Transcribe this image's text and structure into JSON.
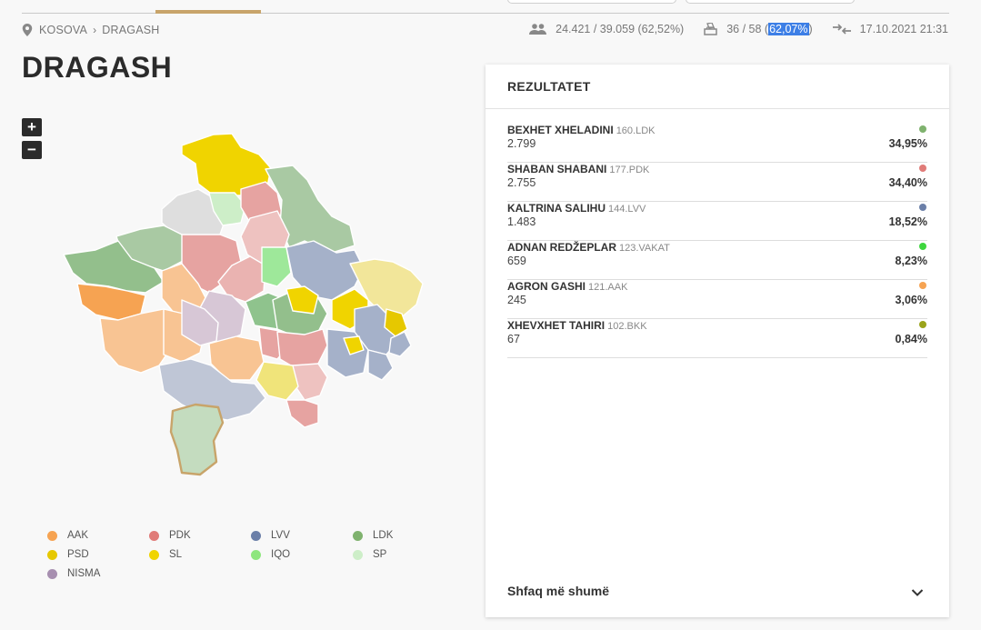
{
  "breadcrumb": {
    "root": "KOSOVA",
    "separator": "›",
    "current": "DRAGASH"
  },
  "stats": {
    "voters": "24.421 / 39.059 (62,52%)",
    "stations_prefix": "36 / 58 (",
    "stations_highlight": "62,07%",
    "stations_suffix": ")",
    "updated": "17.10.2021 21:31"
  },
  "page_title": "DRAGASH",
  "zoom": {
    "in_label": "+",
    "out_label": "−"
  },
  "results": {
    "title": "REZULTATET",
    "candidates": [
      {
        "name": "BEXHET XHELADINI",
        "code": "160.LDK",
        "votes": "2.799",
        "percent": "34,95%",
        "color": "#7fb26e"
      },
      {
        "name": "SHABAN SHABANI",
        "code": "177.PDK",
        "votes": "2.755",
        "percent": "34,40%",
        "color": "#e07b78"
      },
      {
        "name": "KALTRINA SALIHU",
        "code": "144.LVV",
        "votes": "1.483",
        "percent": "18,52%",
        "color": "#6b7fa8"
      },
      {
        "name": "ADNAN REDŽEPLAR",
        "code": "123.VAKAT",
        "votes": "659",
        "percent": "8,23%",
        "color": "#3ed63e"
      },
      {
        "name": "AGRON GASHI",
        "code": "121.AAK",
        "votes": "245",
        "percent": "3,06%",
        "color": "#f6a352"
      },
      {
        "name": "XHEVXHET TAHIRI",
        "code": "102.BKK",
        "votes": "67",
        "percent": "0,84%",
        "color": "#9aa31a"
      }
    ],
    "show_more": "Shfaq më shumë"
  },
  "legend": [
    {
      "label": "AAK",
      "color": "#f6a352"
    },
    {
      "label": "PDK",
      "color": "#e07b78"
    },
    {
      "label": "LVV",
      "color": "#6b7fa8"
    },
    {
      "label": "LDK",
      "color": "#7fb26e"
    },
    {
      "label": "PSD",
      "color": "#e6c800"
    },
    {
      "label": "SL",
      "color": "#f0d400"
    },
    {
      "label": "IQO",
      "color": "#8ee67e"
    },
    {
      "label": "SP",
      "color": "#cdeec8"
    },
    {
      "label": "NISMA",
      "color": "#a78fb0"
    }
  ],
  "colors": {
    "accent": "#c8a46a",
    "highlight": "#3d7fe6"
  }
}
